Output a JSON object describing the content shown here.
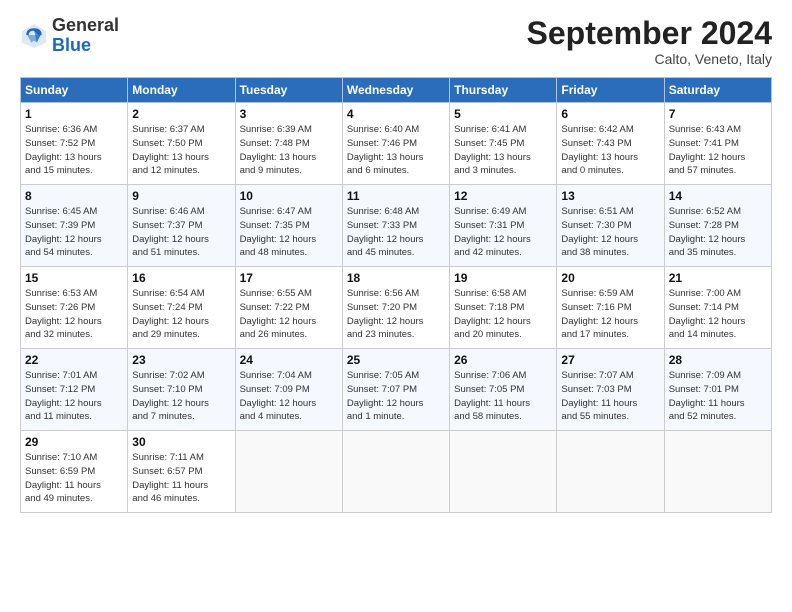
{
  "logo": {
    "general": "General",
    "blue": "Blue"
  },
  "title": "September 2024",
  "subtitle": "Calto, Veneto, Italy",
  "days_header": [
    "Sunday",
    "Monday",
    "Tuesday",
    "Wednesday",
    "Thursday",
    "Friday",
    "Saturday"
  ],
  "weeks": [
    [
      {
        "day": "1",
        "info": "Sunrise: 6:36 AM\nSunset: 7:52 PM\nDaylight: 13 hours\nand 15 minutes."
      },
      {
        "day": "2",
        "info": "Sunrise: 6:37 AM\nSunset: 7:50 PM\nDaylight: 13 hours\nand 12 minutes."
      },
      {
        "day": "3",
        "info": "Sunrise: 6:39 AM\nSunset: 7:48 PM\nDaylight: 13 hours\nand 9 minutes."
      },
      {
        "day": "4",
        "info": "Sunrise: 6:40 AM\nSunset: 7:46 PM\nDaylight: 13 hours\nand 6 minutes."
      },
      {
        "day": "5",
        "info": "Sunrise: 6:41 AM\nSunset: 7:45 PM\nDaylight: 13 hours\nand 3 minutes."
      },
      {
        "day": "6",
        "info": "Sunrise: 6:42 AM\nSunset: 7:43 PM\nDaylight: 13 hours\nand 0 minutes."
      },
      {
        "day": "7",
        "info": "Sunrise: 6:43 AM\nSunset: 7:41 PM\nDaylight: 12 hours\nand 57 minutes."
      }
    ],
    [
      {
        "day": "8",
        "info": "Sunrise: 6:45 AM\nSunset: 7:39 PM\nDaylight: 12 hours\nand 54 minutes."
      },
      {
        "day": "9",
        "info": "Sunrise: 6:46 AM\nSunset: 7:37 PM\nDaylight: 12 hours\nand 51 minutes."
      },
      {
        "day": "10",
        "info": "Sunrise: 6:47 AM\nSunset: 7:35 PM\nDaylight: 12 hours\nand 48 minutes."
      },
      {
        "day": "11",
        "info": "Sunrise: 6:48 AM\nSunset: 7:33 PM\nDaylight: 12 hours\nand 45 minutes."
      },
      {
        "day": "12",
        "info": "Sunrise: 6:49 AM\nSunset: 7:31 PM\nDaylight: 12 hours\nand 42 minutes."
      },
      {
        "day": "13",
        "info": "Sunrise: 6:51 AM\nSunset: 7:30 PM\nDaylight: 12 hours\nand 38 minutes."
      },
      {
        "day": "14",
        "info": "Sunrise: 6:52 AM\nSunset: 7:28 PM\nDaylight: 12 hours\nand 35 minutes."
      }
    ],
    [
      {
        "day": "15",
        "info": "Sunrise: 6:53 AM\nSunset: 7:26 PM\nDaylight: 12 hours\nand 32 minutes."
      },
      {
        "day": "16",
        "info": "Sunrise: 6:54 AM\nSunset: 7:24 PM\nDaylight: 12 hours\nand 29 minutes."
      },
      {
        "day": "17",
        "info": "Sunrise: 6:55 AM\nSunset: 7:22 PM\nDaylight: 12 hours\nand 26 minutes."
      },
      {
        "day": "18",
        "info": "Sunrise: 6:56 AM\nSunset: 7:20 PM\nDaylight: 12 hours\nand 23 minutes."
      },
      {
        "day": "19",
        "info": "Sunrise: 6:58 AM\nSunset: 7:18 PM\nDaylight: 12 hours\nand 20 minutes."
      },
      {
        "day": "20",
        "info": "Sunrise: 6:59 AM\nSunset: 7:16 PM\nDaylight: 12 hours\nand 17 minutes."
      },
      {
        "day": "21",
        "info": "Sunrise: 7:00 AM\nSunset: 7:14 PM\nDaylight: 12 hours\nand 14 minutes."
      }
    ],
    [
      {
        "day": "22",
        "info": "Sunrise: 7:01 AM\nSunset: 7:12 PM\nDaylight: 12 hours\nand 11 minutes."
      },
      {
        "day": "23",
        "info": "Sunrise: 7:02 AM\nSunset: 7:10 PM\nDaylight: 12 hours\nand 7 minutes."
      },
      {
        "day": "24",
        "info": "Sunrise: 7:04 AM\nSunset: 7:09 PM\nDaylight: 12 hours\nand 4 minutes."
      },
      {
        "day": "25",
        "info": "Sunrise: 7:05 AM\nSunset: 7:07 PM\nDaylight: 12 hours\nand 1 minute."
      },
      {
        "day": "26",
        "info": "Sunrise: 7:06 AM\nSunset: 7:05 PM\nDaylight: 11 hours\nand 58 minutes."
      },
      {
        "day": "27",
        "info": "Sunrise: 7:07 AM\nSunset: 7:03 PM\nDaylight: 11 hours\nand 55 minutes."
      },
      {
        "day": "28",
        "info": "Sunrise: 7:09 AM\nSunset: 7:01 PM\nDaylight: 11 hours\nand 52 minutes."
      }
    ],
    [
      {
        "day": "29",
        "info": "Sunrise: 7:10 AM\nSunset: 6:59 PM\nDaylight: 11 hours\nand 49 minutes."
      },
      {
        "day": "30",
        "info": "Sunrise: 7:11 AM\nSunset: 6:57 PM\nDaylight: 11 hours\nand 46 minutes."
      },
      {
        "day": "",
        "info": ""
      },
      {
        "day": "",
        "info": ""
      },
      {
        "day": "",
        "info": ""
      },
      {
        "day": "",
        "info": ""
      },
      {
        "day": "",
        "info": ""
      }
    ]
  ]
}
